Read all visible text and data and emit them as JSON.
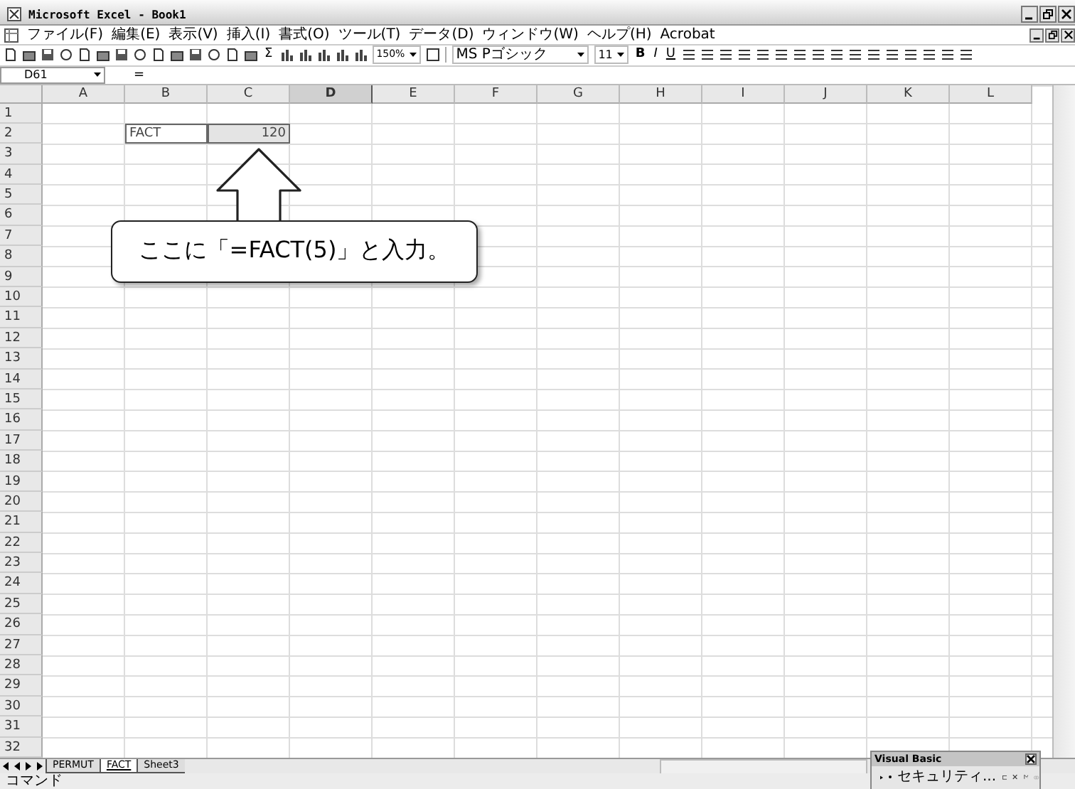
{
  "window": {
    "title": "Microsoft Excel - Book1"
  },
  "menu": [
    "ファイル(F)",
    "編集(E)",
    "表示(V)",
    "挿入(I)",
    "書式(O)",
    "ツール(T)",
    "データ(D)",
    "ウィンドウ(W)",
    "ヘルプ(H)",
    "Acrobat"
  ],
  "toolbar": {
    "sum": "Σ",
    "zoom": "150%",
    "font": "MS Pゴシック",
    "font_size": "11",
    "style_buttons": [
      "B",
      "I",
      "U"
    ]
  },
  "formula_bar": {
    "name_box": "D61",
    "equals": "="
  },
  "columns": [
    {
      "label": "A",
      "selected": false
    },
    {
      "label": "B",
      "selected": false
    },
    {
      "label": "C",
      "selected": false
    },
    {
      "label": "D",
      "selected": true
    },
    {
      "label": "E",
      "selected": false
    },
    {
      "label": "F",
      "selected": false
    },
    {
      "label": "G",
      "selected": false
    },
    {
      "label": "H",
      "selected": false
    },
    {
      "label": "I",
      "selected": false
    },
    {
      "label": "J",
      "selected": false
    },
    {
      "label": "K",
      "selected": false
    },
    {
      "label": "L",
      "selected": false
    }
  ],
  "rows": [
    {
      "number": "1"
    },
    {
      "number": "2",
      "cells": [
        null,
        {
          "kind": "text",
          "value": "FACT",
          "selected": false
        },
        {
          "kind": "number",
          "value": "120",
          "selected": true
        }
      ]
    },
    {
      "number": "3"
    },
    {
      "number": "4"
    },
    {
      "number": "5"
    },
    {
      "number": "6"
    },
    {
      "number": "7"
    },
    {
      "number": "8"
    },
    {
      "number": "9"
    },
    {
      "number": "10"
    },
    {
      "number": "11"
    },
    {
      "number": "12"
    },
    {
      "number": "13"
    },
    {
      "number": "14"
    },
    {
      "number": "15"
    },
    {
      "number": "16"
    },
    {
      "number": "17"
    },
    {
      "number": "18"
    },
    {
      "number": "19"
    },
    {
      "number": "20"
    },
    {
      "number": "21"
    },
    {
      "number": "22"
    },
    {
      "number": "23"
    },
    {
      "number": "24"
    },
    {
      "number": "25"
    },
    {
      "number": "26"
    },
    {
      "number": "27"
    },
    {
      "number": "28"
    },
    {
      "number": "29"
    },
    {
      "number": "30"
    },
    {
      "number": "31"
    },
    {
      "number": "32"
    }
  ],
  "callout": {
    "text": "ここに「=FACT(5)」と入力。"
  },
  "sheet_tabs": [
    {
      "label": "PERMUT",
      "selected": false
    },
    {
      "label": "FACT",
      "selected": true
    },
    {
      "label": "Sheet3",
      "selected": false
    }
  ],
  "vb_toolbar": {
    "title": "Visual Basic",
    "security": "セキュリティ..."
  },
  "status_bar": {
    "text": "コマンド"
  }
}
